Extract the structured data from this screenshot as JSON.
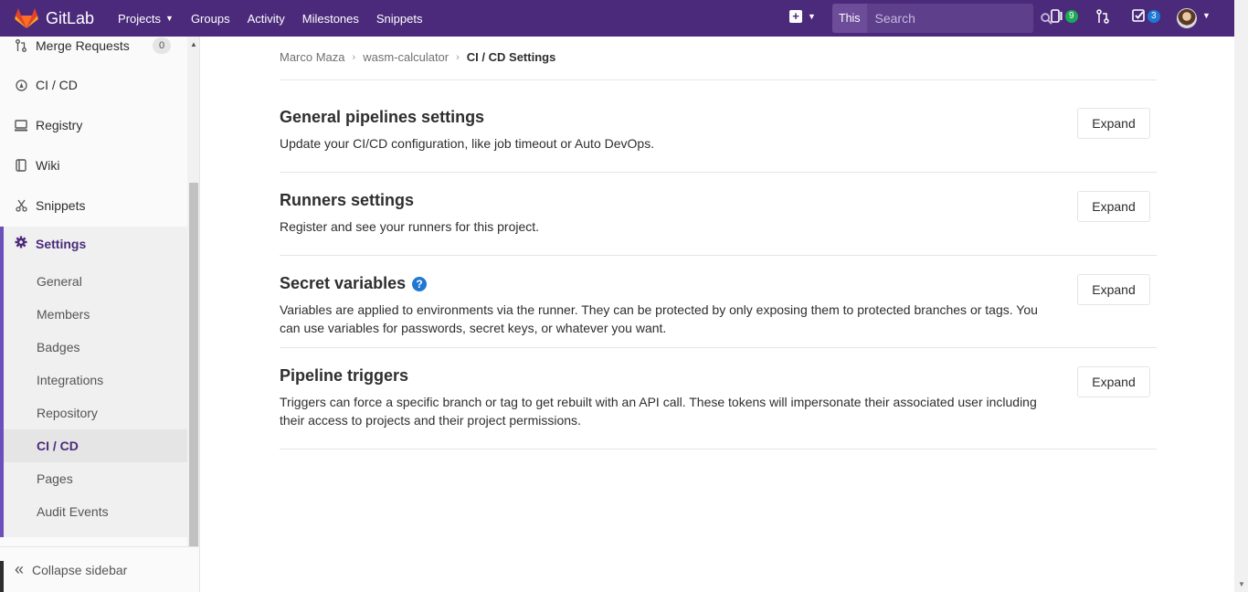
{
  "topnav": {
    "brand": "GitLab",
    "links": [
      "Projects",
      "Groups",
      "Activity",
      "Milestones",
      "Snippets"
    ],
    "search_scope": "This project",
    "search_placeholder": "Search",
    "issues_count": "9",
    "todos_count": "3",
    "colors": {
      "bar": "#4b2a7b"
    }
  },
  "sidebar": {
    "merge_requests": {
      "label": "Merge Requests",
      "count": "0"
    },
    "items": [
      "CI / CD",
      "Registry",
      "Wiki",
      "Snippets"
    ],
    "settings": {
      "label": "Settings",
      "subitems": [
        "General",
        "Members",
        "Badges",
        "Integrations",
        "Repository",
        "CI / CD",
        "Pages",
        "Audit Events"
      ],
      "active": "CI / CD"
    },
    "collapse": "Collapse sidebar"
  },
  "breadcrumb": [
    "Marco Maza",
    "wasm-calculator",
    "CI / CD Settings"
  ],
  "sections": [
    {
      "title": "General pipelines settings",
      "description": "Update your CI/CD configuration, like job timeout or Auto DevOps.",
      "button": "Expand"
    },
    {
      "title": "Runners settings",
      "description": "Register and see your runners for this project.",
      "button": "Expand"
    },
    {
      "title": "Secret variables",
      "description": "Variables are applied to environments via the runner. They can be protected by only exposing them to protected branches or tags. You can use variables for passwords, secret keys, or whatever you want.",
      "button": "Expand"
    },
    {
      "title": "Pipeline triggers",
      "description": "Triggers can force a specific branch or tag to get rebuilt with an API call. These tokens will impersonate their associated user including their access to projects and their project permissions.",
      "button": "Expand"
    }
  ]
}
